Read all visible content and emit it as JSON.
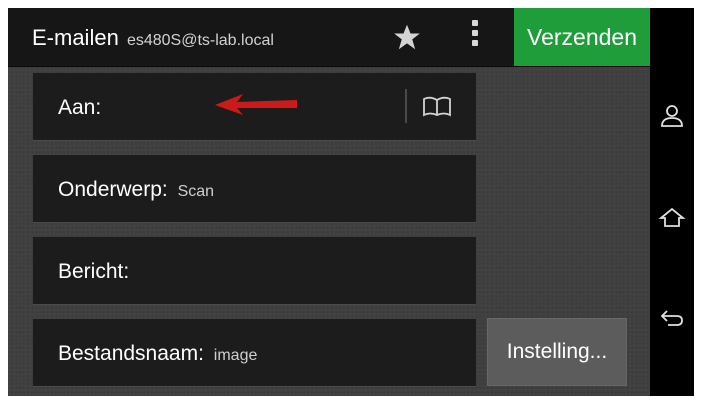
{
  "topbar": {
    "title": "E-mailen",
    "sender": "es480S@ts-lab.local",
    "send_label": "Verzenden"
  },
  "fields": {
    "to": {
      "label": "Aan:"
    },
    "subject": {
      "label": "Onderwerp:",
      "value": "Scan"
    },
    "message": {
      "label": "Bericht:"
    },
    "filename": {
      "label": "Bestandsnaam:",
      "value": "image"
    }
  },
  "settings_label": "Instelling...",
  "icons": [
    "star-icon",
    "overflow-menu-icon",
    "address-book-icon",
    "person-icon",
    "home-icon",
    "back-icon"
  ],
  "colors": {
    "send_button": "#1f9d3a",
    "arrow": "#cc1a1a",
    "field_bg": "#1c1c1c"
  }
}
